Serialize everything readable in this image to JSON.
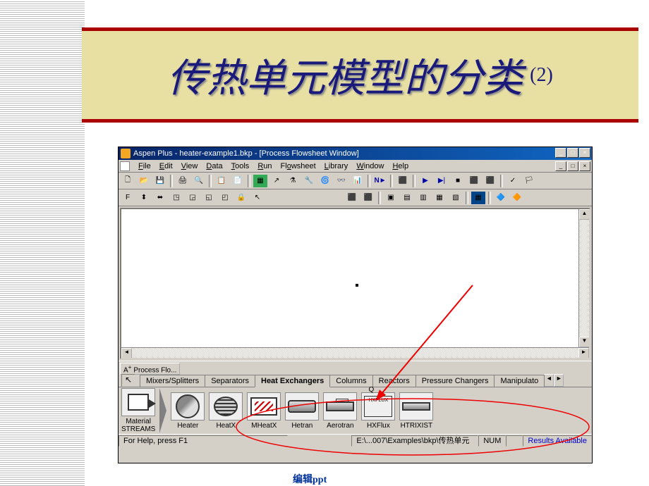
{
  "slide": {
    "title_main": "传热单元模型的分类",
    "title_suffix": "(2)",
    "footer": "编辑ppt"
  },
  "app": {
    "title": "Aspen Plus - heater-example1.bkp - [Process Flowsheet Window]"
  },
  "menus": [
    "File",
    "Edit",
    "View",
    "Data",
    "Tools",
    "Run",
    "Flowsheet",
    "Library",
    "Window",
    "Help"
  ],
  "process_tab": "Process Flo...",
  "palette_tabs": {
    "arrow": "↖",
    "items": [
      "Mixers/Splitters",
      "Separators",
      "Heat Exchangers",
      "Columns",
      "Reactors",
      "Pressure Changers",
      "Manipulato"
    ],
    "active_index": 2
  },
  "palette_items": [
    {
      "label": "Material\nSTREAMS",
      "icon": "stream"
    },
    {
      "label": "Heater",
      "icon": "heater"
    },
    {
      "label": "HeatX",
      "icon": "heatx"
    },
    {
      "label": "MHeatX",
      "icon": "mheatx"
    },
    {
      "label": "Hetran",
      "icon": "hetran"
    },
    {
      "label": "Aerotran",
      "icon": "aero"
    },
    {
      "label": "HXFlux",
      "icon": "flux",
      "flux_text": "HXFLUX"
    },
    {
      "label": "HTRIXIST",
      "icon": "htri"
    }
  ],
  "statusbar": {
    "help": "For Help, press F1",
    "path": "E:\\...007\\Examples\\bkp\\传热单元",
    "num": "NUM",
    "results": "Results Available"
  },
  "window_buttons": {
    "min": "_",
    "max": "□",
    "close": "×"
  }
}
